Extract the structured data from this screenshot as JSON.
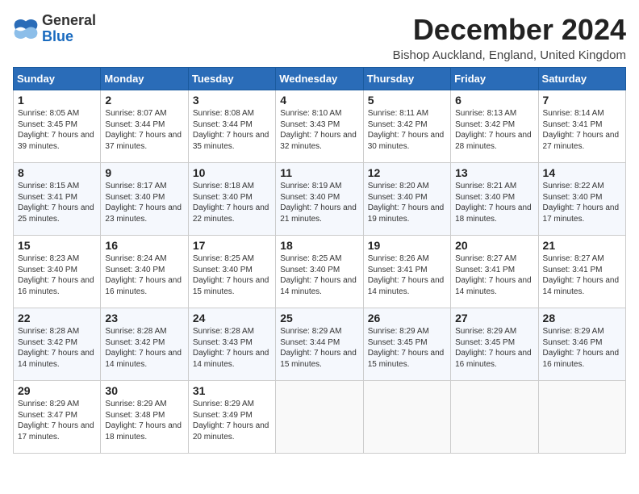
{
  "logo": {
    "general": "General",
    "blue": "Blue"
  },
  "header": {
    "month": "December 2024",
    "location": "Bishop Auckland, England, United Kingdom"
  },
  "days_of_week": [
    "Sunday",
    "Monday",
    "Tuesday",
    "Wednesday",
    "Thursday",
    "Friday",
    "Saturday"
  ],
  "weeks": [
    [
      {
        "day": "1",
        "sunrise": "8:05 AM",
        "sunset": "3:45 PM",
        "daylight": "7 hours and 39 minutes."
      },
      {
        "day": "2",
        "sunrise": "8:07 AM",
        "sunset": "3:44 PM",
        "daylight": "7 hours and 37 minutes."
      },
      {
        "day": "3",
        "sunrise": "8:08 AM",
        "sunset": "3:44 PM",
        "daylight": "7 hours and 35 minutes."
      },
      {
        "day": "4",
        "sunrise": "8:10 AM",
        "sunset": "3:43 PM",
        "daylight": "7 hours and 32 minutes."
      },
      {
        "day": "5",
        "sunrise": "8:11 AM",
        "sunset": "3:42 PM",
        "daylight": "7 hours and 30 minutes."
      },
      {
        "day": "6",
        "sunrise": "8:13 AM",
        "sunset": "3:42 PM",
        "daylight": "7 hours and 28 minutes."
      },
      {
        "day": "7",
        "sunrise": "8:14 AM",
        "sunset": "3:41 PM",
        "daylight": "7 hours and 27 minutes."
      }
    ],
    [
      {
        "day": "8",
        "sunrise": "8:15 AM",
        "sunset": "3:41 PM",
        "daylight": "7 hours and 25 minutes."
      },
      {
        "day": "9",
        "sunrise": "8:17 AM",
        "sunset": "3:40 PM",
        "daylight": "7 hours and 23 minutes."
      },
      {
        "day": "10",
        "sunrise": "8:18 AM",
        "sunset": "3:40 PM",
        "daylight": "7 hours and 22 minutes."
      },
      {
        "day": "11",
        "sunrise": "8:19 AM",
        "sunset": "3:40 PM",
        "daylight": "7 hours and 21 minutes."
      },
      {
        "day": "12",
        "sunrise": "8:20 AM",
        "sunset": "3:40 PM",
        "daylight": "7 hours and 19 minutes."
      },
      {
        "day": "13",
        "sunrise": "8:21 AM",
        "sunset": "3:40 PM",
        "daylight": "7 hours and 18 minutes."
      },
      {
        "day": "14",
        "sunrise": "8:22 AM",
        "sunset": "3:40 PM",
        "daylight": "7 hours and 17 minutes."
      }
    ],
    [
      {
        "day": "15",
        "sunrise": "8:23 AM",
        "sunset": "3:40 PM",
        "daylight": "7 hours and 16 minutes."
      },
      {
        "day": "16",
        "sunrise": "8:24 AM",
        "sunset": "3:40 PM",
        "daylight": "7 hours and 16 minutes."
      },
      {
        "day": "17",
        "sunrise": "8:25 AM",
        "sunset": "3:40 PM",
        "daylight": "7 hours and 15 minutes."
      },
      {
        "day": "18",
        "sunrise": "8:25 AM",
        "sunset": "3:40 PM",
        "daylight": "7 hours and 14 minutes."
      },
      {
        "day": "19",
        "sunrise": "8:26 AM",
        "sunset": "3:41 PM",
        "daylight": "7 hours and 14 minutes."
      },
      {
        "day": "20",
        "sunrise": "8:27 AM",
        "sunset": "3:41 PM",
        "daylight": "7 hours and 14 minutes."
      },
      {
        "day": "21",
        "sunrise": "8:27 AM",
        "sunset": "3:41 PM",
        "daylight": "7 hours and 14 minutes."
      }
    ],
    [
      {
        "day": "22",
        "sunrise": "8:28 AM",
        "sunset": "3:42 PM",
        "daylight": "7 hours and 14 minutes."
      },
      {
        "day": "23",
        "sunrise": "8:28 AM",
        "sunset": "3:42 PM",
        "daylight": "7 hours and 14 minutes."
      },
      {
        "day": "24",
        "sunrise": "8:28 AM",
        "sunset": "3:43 PM",
        "daylight": "7 hours and 14 minutes."
      },
      {
        "day": "25",
        "sunrise": "8:29 AM",
        "sunset": "3:44 PM",
        "daylight": "7 hours and 15 minutes."
      },
      {
        "day": "26",
        "sunrise": "8:29 AM",
        "sunset": "3:45 PM",
        "daylight": "7 hours and 15 minutes."
      },
      {
        "day": "27",
        "sunrise": "8:29 AM",
        "sunset": "3:45 PM",
        "daylight": "7 hours and 16 minutes."
      },
      {
        "day": "28",
        "sunrise": "8:29 AM",
        "sunset": "3:46 PM",
        "daylight": "7 hours and 16 minutes."
      }
    ],
    [
      {
        "day": "29",
        "sunrise": "8:29 AM",
        "sunset": "3:47 PM",
        "daylight": "7 hours and 17 minutes."
      },
      {
        "day": "30",
        "sunrise": "8:29 AM",
        "sunset": "3:48 PM",
        "daylight": "7 hours and 18 minutes."
      },
      {
        "day": "31",
        "sunrise": "8:29 AM",
        "sunset": "3:49 PM",
        "daylight": "7 hours and 20 minutes."
      },
      null,
      null,
      null,
      null
    ]
  ],
  "labels": {
    "sunrise_prefix": "Sunrise: ",
    "sunset_prefix": "Sunset: ",
    "daylight_prefix": "Daylight: "
  }
}
